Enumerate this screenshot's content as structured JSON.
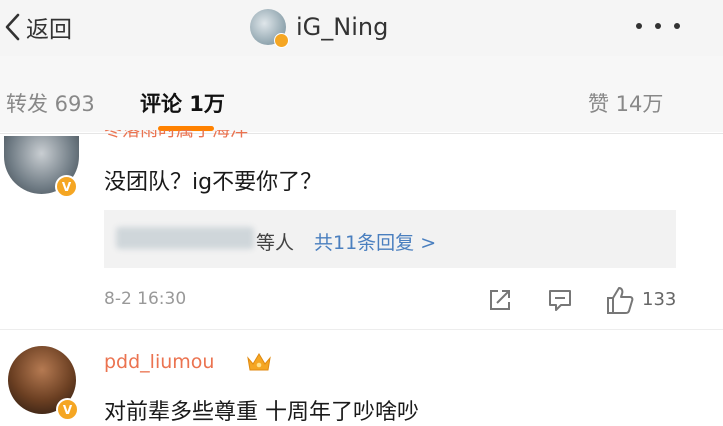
{
  "header": {
    "back_label": "返回",
    "title": "iG_Ning"
  },
  "tabs": {
    "repost": "转发 693",
    "comments": "评论 1万",
    "likes": "赞 14万"
  },
  "comments": [
    {
      "name": "冬落雨时属于海洋",
      "text": "没团队？ig不要你了？",
      "replies_suffix": "等人",
      "replies_link": "共11条回复 >",
      "time": "8-2 16:30",
      "likes": "133"
    },
    {
      "name": "pdd_liumou",
      "text": "对前辈多些尊重 十周年了吵啥吵"
    }
  ],
  "icons": {
    "back": "chevron-left-icon",
    "more": "more-dots-icon",
    "share": "share-icon",
    "comment": "comment-icon",
    "like": "thumbs-up-icon",
    "crown": "crown-icon",
    "verified": "verified-badge-icon"
  },
  "colors": {
    "accent": "#ff8200",
    "username": "#eb7350",
    "link": "#4a7fbf",
    "verified": "#f5a623"
  }
}
